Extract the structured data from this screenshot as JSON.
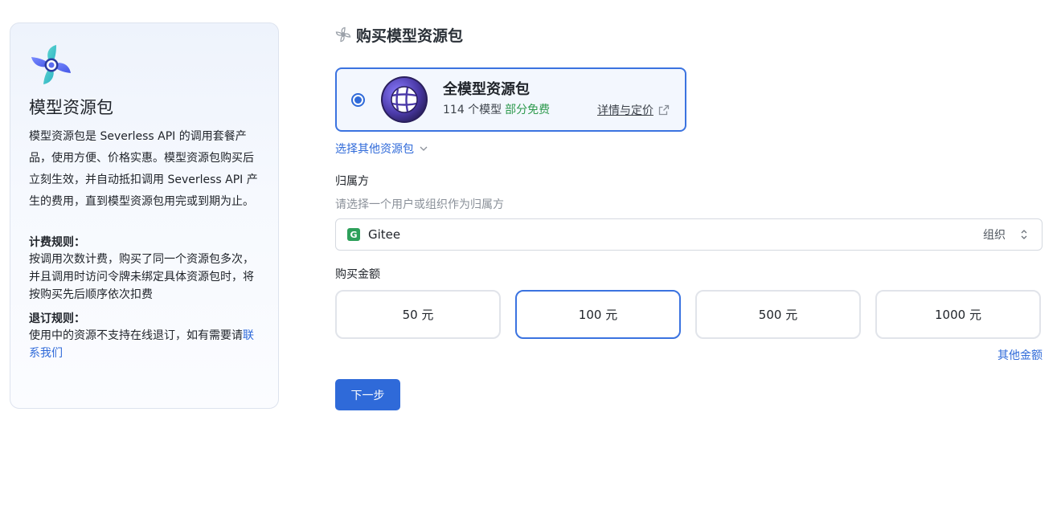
{
  "sidebar": {
    "title": "模型资源包",
    "description": "模型资源包是 Severless API 的调用套餐产品，使用方便、价格实惠。模型资源包购买后立刻生效，并自动抵扣调用 Severless API 产生的费用，直到模型资源包用完或到期为止。",
    "billing_rule": {
      "title": "计费规则：",
      "text": "按调用次数计费，购买了同一个资源包多次，并且调用时访问令牌未绑定具体资源包时，将按购买先后顺序依次扣费"
    },
    "refund_rule": {
      "title": "退订规则：",
      "text_prefix": "使用中的资源不支持在线退订，如有需要请",
      "contact_link": "联系我们"
    }
  },
  "header": {
    "title": "购买模型资源包"
  },
  "package": {
    "name": "全模型资源包",
    "model_count": "114 个模型",
    "free_badge": "部分免费",
    "detail_link": "详情与定价",
    "selected": true
  },
  "choose_other": "选择其他资源包",
  "owner": {
    "label": "归属方",
    "hint": "请选择一个用户或组织作为归属方",
    "badge": "G",
    "name": "Gitee",
    "type": "组织"
  },
  "amount": {
    "label": "购买金额",
    "options": [
      {
        "label": "50 元",
        "selected": false
      },
      {
        "label": "100 元",
        "selected": true
      },
      {
        "label": "500 元",
        "selected": false
      },
      {
        "label": "1000 元",
        "selected": false
      }
    ],
    "other": "其他金额"
  },
  "next_button": "下一步",
  "colors": {
    "primary": "#2f6ad9",
    "free_green": "#2e9a4e",
    "owner_badge": "#2ea05b"
  },
  "icons": {
    "sidebar_logo": "pinwheel-logo-icon",
    "header": "pinwheel-outline-icon",
    "package_logo": "globe-grid-icon",
    "detail": "external-link-icon",
    "chevron": "chevron-down-icon",
    "select": "chevron-up-down-icon"
  }
}
